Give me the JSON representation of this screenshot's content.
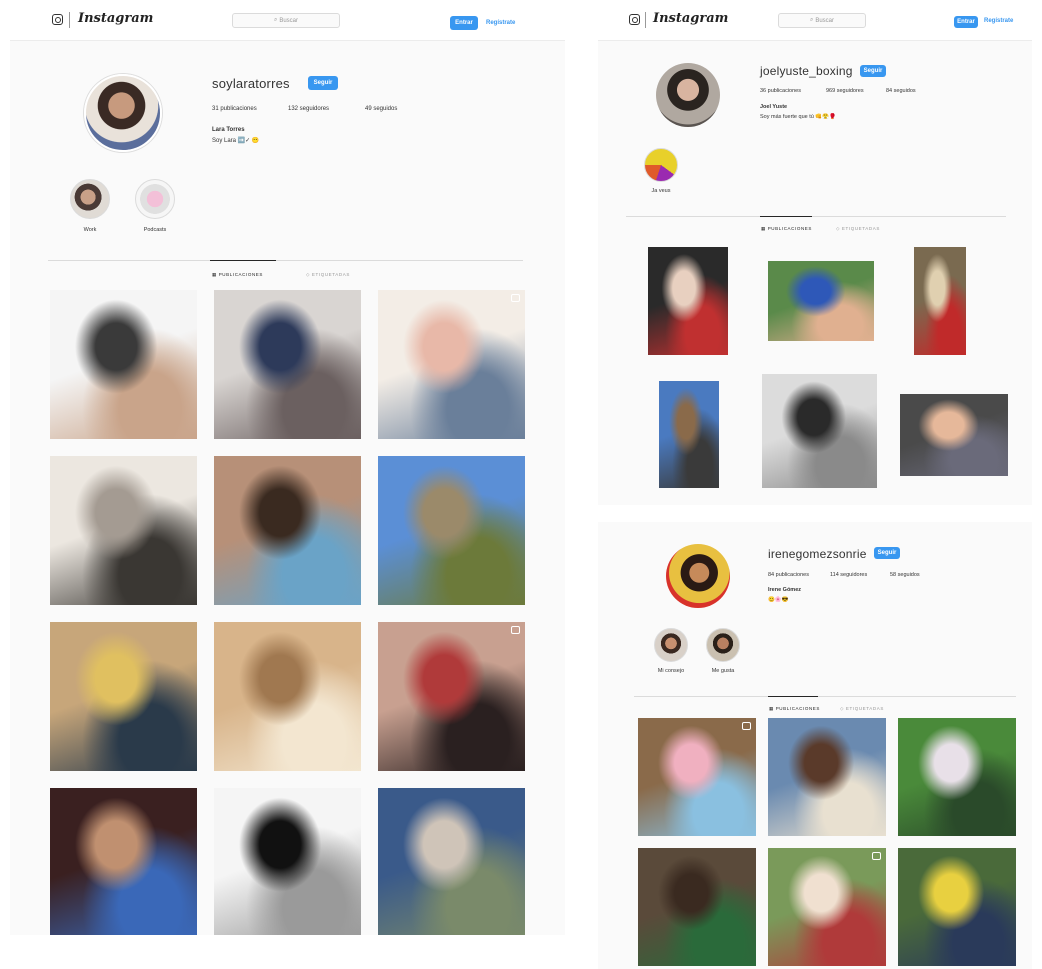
{
  "left": {
    "brand": "Instagram",
    "search_placeholder": "Buscar",
    "login_label": "Entrar",
    "signup_label": "Regístrate",
    "username": "soylaratorres",
    "follow_label": "Seguir",
    "stats": {
      "posts": "31 publicaciones",
      "followers": "132 seguidores",
      "following": "49 seguidos"
    },
    "full_name": "Lara Torres",
    "bio": "Soy Lara ➡️✓ 😶",
    "highlights": [
      {
        "label": "Work"
      },
      {
        "label": "Podcasts"
      }
    ],
    "tabs": {
      "posts": "PUBLICACIONES",
      "tagged": "ETIQUETADAS"
    },
    "posts": [
      {
        "name": "sketch-eyes-photo",
        "colors": [
          "#f5f5f5",
          "#3a3a3a",
          "#c9a48a"
        ]
      },
      {
        "name": "girl-with-drawings-photo",
        "colors": [
          "#d9d5d2",
          "#2d3a5a",
          "#6b6060"
        ]
      },
      {
        "name": "girl-lamp-photo",
        "colors": [
          "#f3ede6",
          "#e8b8a8",
          "#6a7f9a"
        ]
      },
      {
        "name": "guitar-sketch-photo",
        "colors": [
          "#ece7e0",
          "#a49b92",
          "#3a3733"
        ]
      },
      {
        "name": "face-pencil-photo",
        "colors": [
          "#b79078",
          "#3a2a20",
          "#6aa3c7"
        ]
      },
      {
        "name": "railway-photo",
        "colors": [
          "#5b8fd6",
          "#9b8a6a",
          "#6c7a3a"
        ]
      },
      {
        "name": "girl-yellow-sweater-photo",
        "colors": [
          "#c7a67a",
          "#e0c060",
          "#2a3a4a"
        ]
      },
      {
        "name": "sketches-on-wood-photo",
        "colors": [
          "#d8b48a",
          "#a07850",
          "#f3e6d0"
        ]
      },
      {
        "name": "girl-drawing-red-photo",
        "colors": [
          "#c8a090",
          "#b03a3a",
          "#2a2020"
        ]
      },
      {
        "name": "girl-pencils-photo",
        "colors": [
          "#3a2020",
          "#c09070",
          "#3a68b8"
        ]
      },
      {
        "name": "ink-drawing-photo",
        "colors": [
          "#f5f5f5",
          "#111111",
          "#9a9a9a"
        ]
      },
      {
        "name": "girl-with-book-photo",
        "colors": [
          "#3a5a8a",
          "#cfc4b8",
          "#7a8a6a"
        ]
      }
    ]
  },
  "right_top": {
    "brand": "Instagram",
    "search_placeholder": "Buscar",
    "login_label": "Entrar",
    "signup_label": "Regístrate",
    "username": "joelyuste_boxing",
    "follow_label": "Seguir",
    "stats": {
      "posts": "36 publicaciones",
      "followers": "969 seguidores",
      "following": "84 seguidos"
    },
    "full_name": "Joel Yuste",
    "bio": "Soy más fuerte que tú 👊😤🥊",
    "highlights": [
      {
        "label": "Ja veus"
      }
    ],
    "tabs": {
      "posts": "PUBLICACIONES",
      "tagged": "ETIQUETADAS"
    },
    "posts": [
      {
        "name": "boxer-wrapping-hands-photo",
        "colors": [
          "#2a2a2a",
          "#e8d0c0",
          "#c03030"
        ]
      },
      {
        "name": "boy-blue-shirt-photo",
        "colors": [
          "#5a8a4a",
          "#2e58b8",
          "#e0b090"
        ]
      },
      {
        "name": "boy-red-bag-photo",
        "colors": [
          "#7a6a50",
          "#e0d0b0",
          "#c02a2a"
        ]
      },
      {
        "name": "boy-on-tracks-photo",
        "colors": [
          "#4a7ac0",
          "#8a6a4a",
          "#3a3a3a"
        ]
      },
      {
        "name": "bw-collage-photo",
        "colors": [
          "#dcdcdc",
          "#2a2a2a",
          "#8a8a8a"
        ]
      },
      {
        "name": "boy-laughing-photo",
        "colors": [
          "#4a4a4a",
          "#e6b89a",
          "#6a6a7a"
        ]
      }
    ]
  },
  "right_bottom": {
    "username": "irenegomezsonrie",
    "follow_label": "Seguir",
    "stats": {
      "posts": "84 publicaciones",
      "followers": "114 seguidores",
      "following": "58 seguidos"
    },
    "full_name": "Irene Gómez",
    "bio": "😊🌸😎",
    "highlights": [
      {
        "label": "Mi consejo"
      },
      {
        "label": "Me gusta"
      }
    ],
    "tabs": {
      "posts": "PUBLICACIONES",
      "tagged": "ETIQUETADAS"
    },
    "posts": [
      {
        "name": "girl-rainbow-sweater-photo",
        "colors": [
          "#8a6a4a",
          "#f0b0c0",
          "#8ac0e0"
        ]
      },
      {
        "name": "girl-laughing-bookshelf-photo",
        "colors": [
          "#6a8ab0",
          "#5a3a2a",
          "#e8e0d0"
        ]
      },
      {
        "name": "girl-in-garden-photo",
        "colors": [
          "#4a8a3a",
          "#e8e0e8",
          "#2a4a2a"
        ]
      },
      {
        "name": "girl-smiling-fence-photo",
        "colors": [
          "#5a4a3a",
          "#3a2a20",
          "#2a6a3a"
        ]
      },
      {
        "name": "girl-sitting-grass-photo",
        "colors": [
          "#7a9a5a",
          "#f0e0d0",
          "#b03a3a"
        ]
      },
      {
        "name": "girl-yellow-shirt-photo",
        "colors": [
          "#4a6a3a",
          "#e8d040",
          "#2a3a5a"
        ]
      }
    ]
  },
  "colors": {
    "accent": "#3897f0",
    "divider": "#dbdbdb",
    "panel_bg": "#fafafa"
  }
}
